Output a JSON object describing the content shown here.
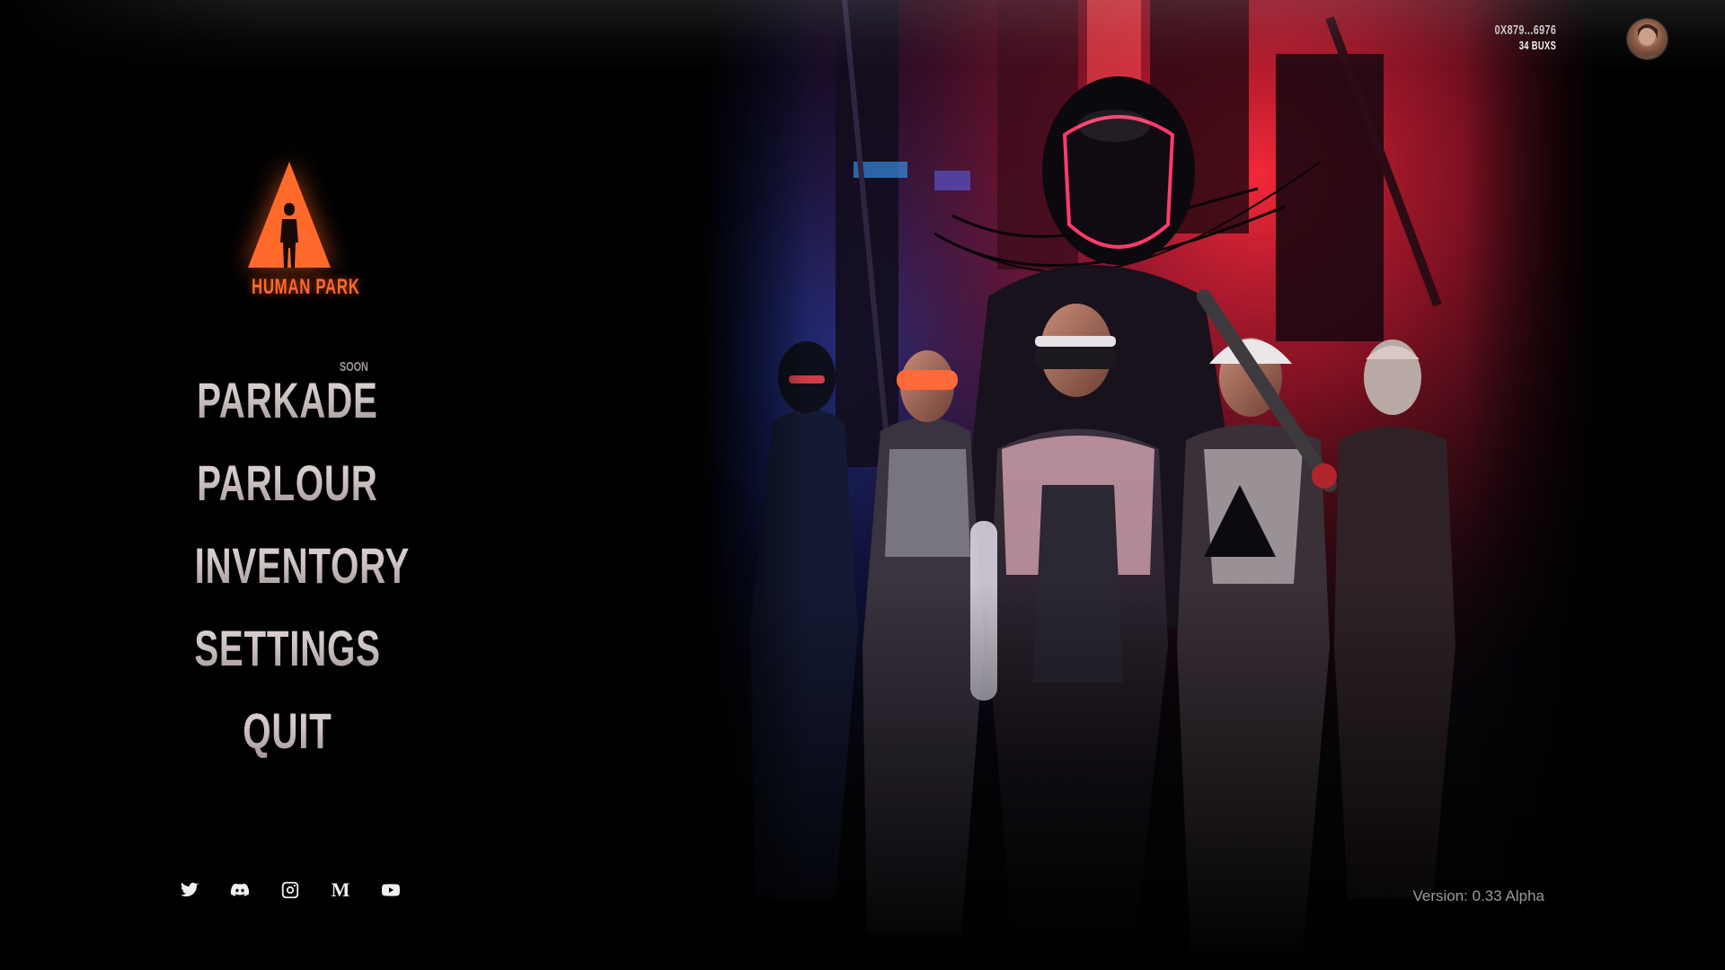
{
  "account": {
    "wallet_address": "0X879...6976",
    "balance": "34 BUXS"
  },
  "logo": {
    "text": "HUMAN PARK",
    "color": "#ff6a2b"
  },
  "menu": {
    "items": [
      {
        "label": "PARKADE",
        "badge": "SOON"
      },
      {
        "label": "PARLOUR"
      },
      {
        "label": "INVENTORY"
      },
      {
        "label": "SETTINGS"
      },
      {
        "label": "QUIT"
      }
    ]
  },
  "social": {
    "icons": [
      "twitter-icon",
      "discord-icon",
      "instagram-icon",
      "medium-icon",
      "youtube-icon"
    ],
    "medium_glyph": "M"
  },
  "footer": {
    "version": "Version: 0.33 Alpha"
  },
  "background": {
    "scene": "cyberpunk-characters-group",
    "accent_blue": "#2a48c8",
    "accent_red": "#e8203a"
  }
}
